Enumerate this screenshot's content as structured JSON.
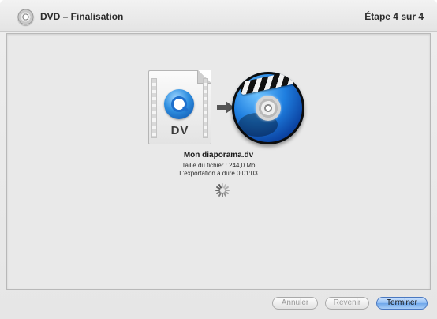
{
  "window": {
    "title": "DVD – Finalisation",
    "step": "Étape 4 sur 4"
  },
  "icons": {
    "title": "dvd-disc-icon",
    "document": "dv-movie-file-icon",
    "arrow": "right-arrow-icon",
    "target": "idvd-app-icon",
    "spinner": "activity-spinner-icon"
  },
  "document": {
    "label": "DV"
  },
  "file": {
    "name": "Mon diaporama.dv",
    "size": "Taille du fichier : 244,0 Mo",
    "export_time": "L'exportation a duré 0:01:03"
  },
  "buttons": {
    "cancel": "Annuler",
    "back": "Revenir",
    "finish": "Terminer"
  },
  "colors": {
    "default_button": "#6ea6ea",
    "window_bg": "#e9e9e9"
  }
}
